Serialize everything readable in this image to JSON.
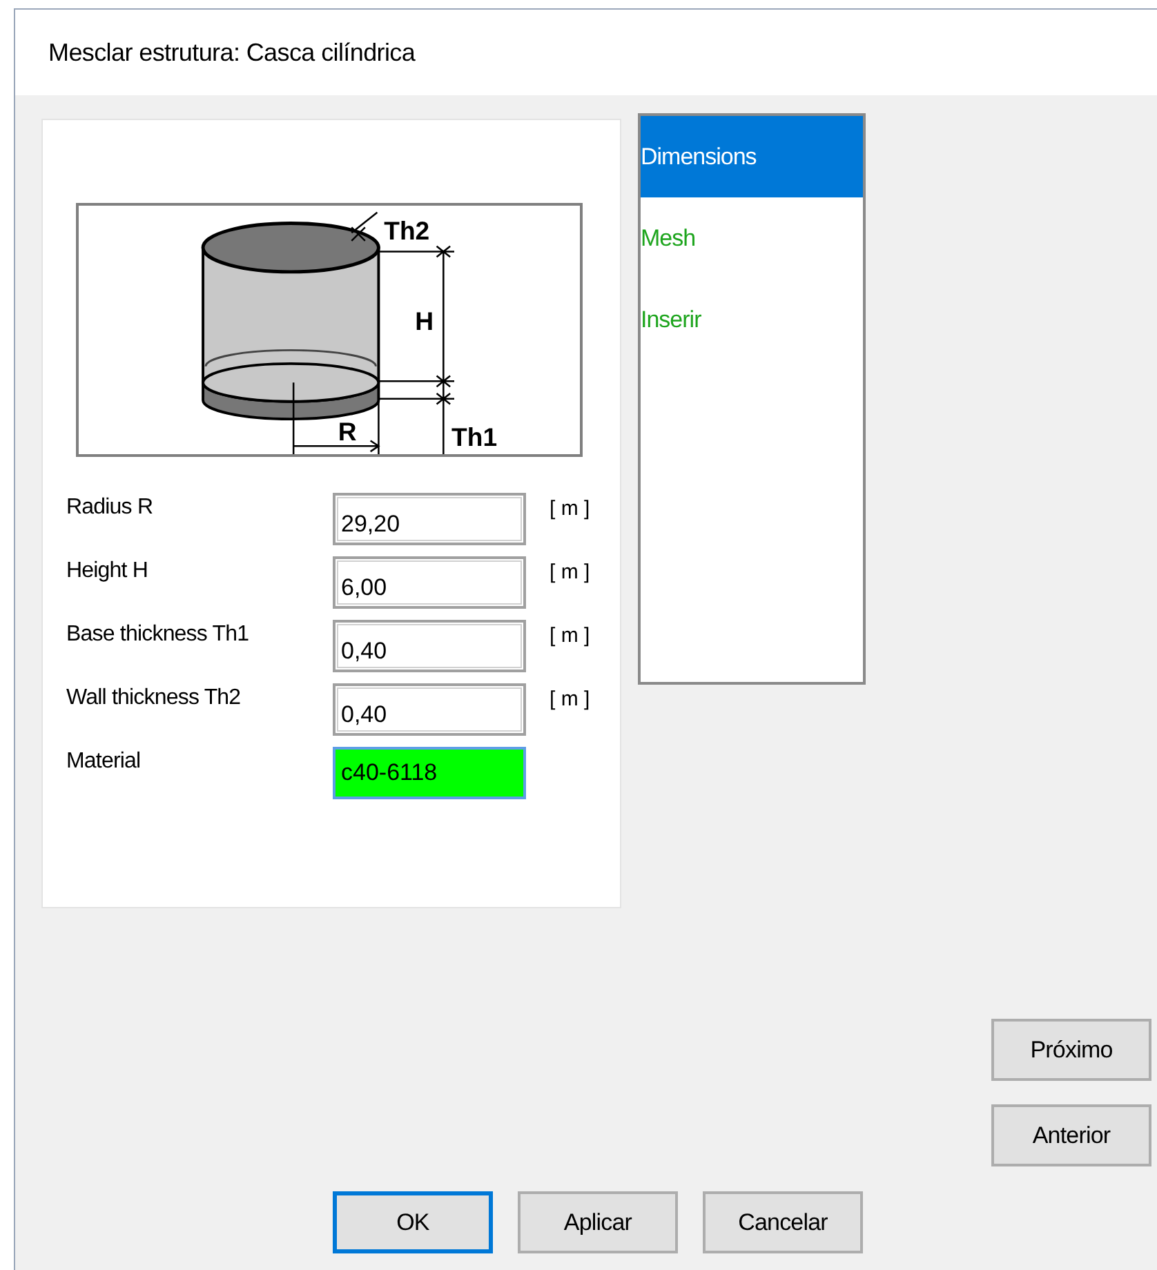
{
  "window": {
    "title": "Mesclar estrutura: Casca cilíndrica"
  },
  "diagram": {
    "labels": [
      {
        "kind": "th2",
        "text": "Th2"
      },
      {
        "kind": "h",
        "text": "H"
      },
      {
        "kind": "r",
        "text": "R"
      },
      {
        "kind": "th1",
        "text": "Th1"
      }
    ]
  },
  "fields": [
    {
      "label": "Radius  R",
      "value": "29,20",
      "unit": "[ m ]",
      "focused": false
    },
    {
      "label": "Height  H",
      "value": "6,00",
      "unit": "[ m ]",
      "focused": false
    },
    {
      "label": "Base thickness Th1",
      "value": "0,40",
      "unit": "[ m ]",
      "focused": false
    },
    {
      "label": "Wall thickness Th2",
      "value": "0,40",
      "unit": "[ m ]",
      "focused": false
    },
    {
      "label": "Material",
      "value": "c40-6118",
      "focused": true
    }
  ],
  "nav": [
    {
      "label": "Dimensions",
      "selected": true
    },
    {
      "label": "Mesh",
      "selected": false
    },
    {
      "label": "Inserir",
      "selected": false
    }
  ],
  "side_buttons": [
    "Próximo",
    "Anterior"
  ],
  "buttons": [
    {
      "label": "OK",
      "default": true
    },
    {
      "label": "Aplicar",
      "default": false
    },
    {
      "label": "Cancelar",
      "default": false
    }
  ]
}
